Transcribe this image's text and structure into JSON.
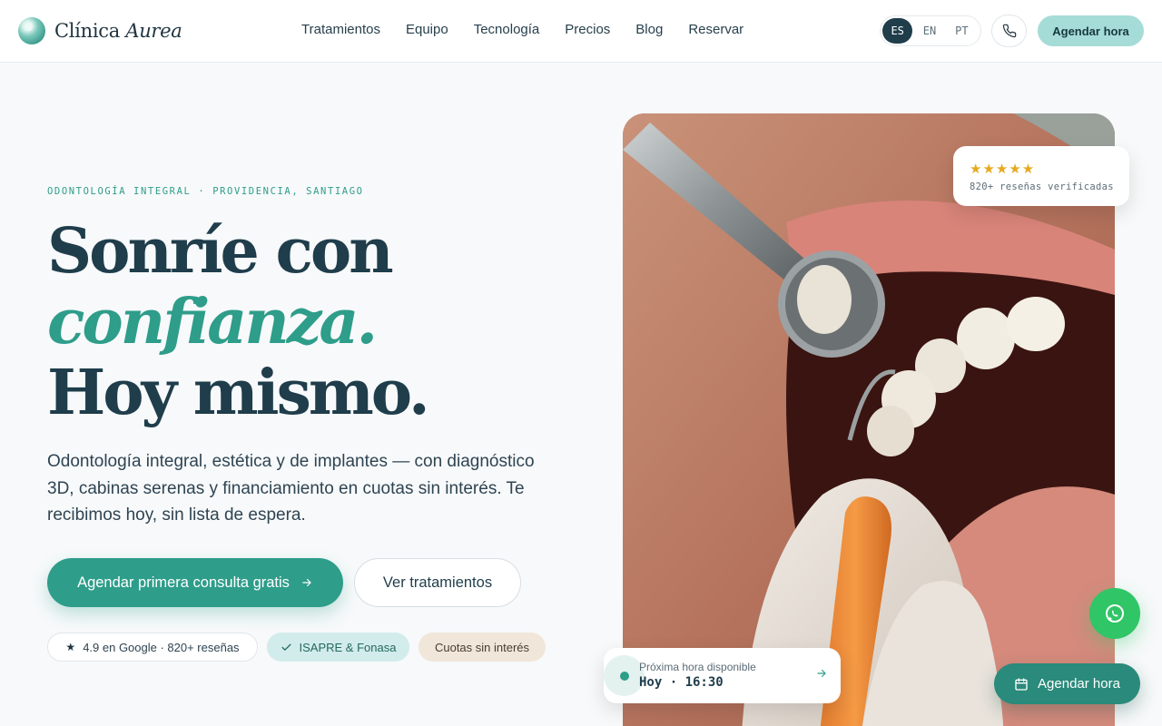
{
  "brand": {
    "name": "Clínica",
    "name_italic": "Aurea"
  },
  "nav": [
    "Tratamientos",
    "Equipo",
    "Tecnología",
    "Precios",
    "Blog",
    "Reservar"
  ],
  "languages": {
    "items": [
      "ES",
      "EN",
      "PT"
    ],
    "active": "ES"
  },
  "header": {
    "cta_label": "Agendar hora"
  },
  "hero": {
    "eyebrow": "ODONTOLOGÍA INTEGRAL · PROVIDENCIA, SANTIAGO",
    "headline_line1": "Sonríe con",
    "headline_line2": "confianza.",
    "headline_line3": "Hoy mismo.",
    "lead": "Odontología integral, estética y de implantes — con diagnóstico 3D, cabinas serenas y financiamiento en cuotas sin interés. Te recibimos hoy, sin lista de espera.",
    "primary_cta": "Agendar primera consulta gratis",
    "secondary_cta": "Ver tratamientos"
  },
  "chips": {
    "rating": "4.9 en Google · 820+ reseñas",
    "isapre": "ISAPRE & Fonasa",
    "cuotas": "Cuotas sin interés"
  },
  "review_card": {
    "stars": "★★★★★",
    "text": "820+ reseñas verificadas"
  },
  "next_slot": {
    "label": "Próxima hora disponible",
    "time": "Hoy · 16:30"
  },
  "floating_cta": "Agendar hora",
  "colors": {
    "accent": "#2e9d8a",
    "dark": "#1f3d4b",
    "whatsapp": "#30c566",
    "star": "#e6a91f"
  }
}
